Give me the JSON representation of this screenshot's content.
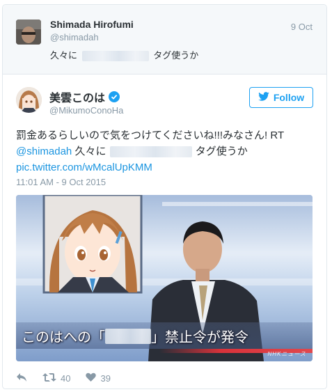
{
  "parent_tweet": {
    "name": "Shimada Hirofumi",
    "handle": "@shimadah",
    "date": "9 Oct",
    "text_before": "久々に",
    "text_after": "タグ使うか"
  },
  "main_tweet": {
    "name": "美雲このは",
    "handle": "@MikumoConoHa",
    "follow_label": "Follow",
    "line1": "罰金あるらしいので気をつけてくださいね!!!みなさん! RT",
    "mention": "@shimadah",
    "quote_before": " 久々に",
    "quote_after": " タグ使うか",
    "link": "pic.twitter.com/wMcalUpKMM",
    "timestamp": "11:01 AM - 9 Oct 2015"
  },
  "media": {
    "caption_before": "このはへの「",
    "caption_after": "」禁止令が発令",
    "broadcaster": "NHKニュース"
  },
  "actions": {
    "retweet_count": "40",
    "like_count": "39"
  },
  "colors": {
    "accent": "#1da1f2",
    "link": "#1b95e0",
    "muted": "#8899a6"
  },
  "icons": [
    "reply-icon",
    "retweet-icon",
    "heart-icon",
    "twitter-bird-icon",
    "verified-badge-icon"
  ]
}
